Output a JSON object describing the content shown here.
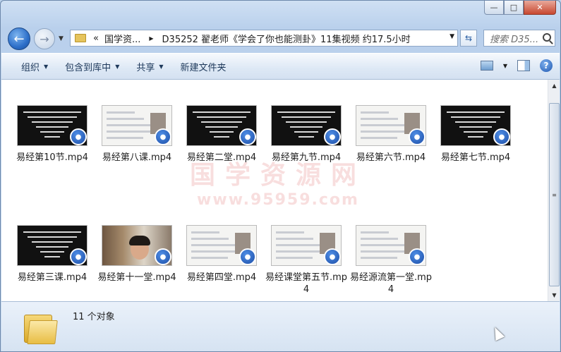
{
  "window": {
    "minimize": "—",
    "maximize": "□",
    "close": "✕"
  },
  "address_bar": {
    "chevron": "«",
    "segments": [
      "国学资...",
      "D35252 翟老师《学会了你也能测卦》11集视频 约17.5小时"
    ],
    "search_placeholder": "搜索 D35..."
  },
  "toolbar": {
    "organize": "组织",
    "include_in_library": "包含到库中",
    "share": "共享",
    "new_folder": "新建文件夹"
  },
  "files": [
    {
      "name": "易经第10节.mp4",
      "thumb": "dark"
    },
    {
      "name": "易经第八课.mp4",
      "thumb": "slide"
    },
    {
      "name": "易经第二堂.mp4",
      "thumb": "dark"
    },
    {
      "name": "易经第九节.mp4",
      "thumb": "dark"
    },
    {
      "name": "易经第六节.mp4",
      "thumb": "slide"
    },
    {
      "name": "易经第七节.mp4",
      "thumb": "dark"
    },
    {
      "name": "易经第三课.mp4",
      "thumb": "dark"
    },
    {
      "name": "易经第十一堂.mp4",
      "thumb": "person"
    },
    {
      "name": "易经第四堂.mp4",
      "thumb": "slide"
    },
    {
      "name": "易经课堂第五节.mp4",
      "thumb": "slide"
    },
    {
      "name": "易经源流第一堂.mp4",
      "thumb": "slide"
    }
  ],
  "watermark": {
    "line1": "国学资源网",
    "line2": "www.95959.com"
  },
  "statusbar": {
    "count_text": "11 个对象"
  },
  "colors": {
    "accent": "#1d4fa8",
    "toolbar_text": "#1e395b",
    "close_button": "#c7472f"
  }
}
